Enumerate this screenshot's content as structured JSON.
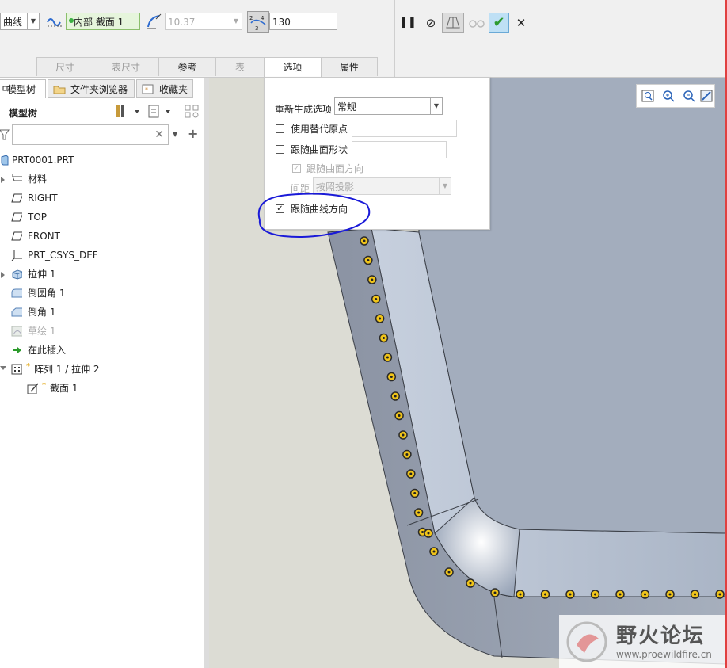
{
  "dashboard": {
    "curve_type": "曲线",
    "section_combo": "内部 截面 1",
    "distance_value": "10.37",
    "count_value": "130",
    "tabs": [
      {
        "label": "尺寸",
        "state": "disabled"
      },
      {
        "label": "表尺寸",
        "state": "disabled"
      },
      {
        "label": "参考",
        "state": "enabled"
      },
      {
        "label": "表",
        "state": "disabled"
      },
      {
        "label": "选项",
        "state": "active"
      },
      {
        "label": "属性",
        "state": "enabled"
      }
    ],
    "actions": {
      "pause": "❚❚",
      "stop": "⊘",
      "ok": "✔",
      "cancel": "✕"
    }
  },
  "options_panel": {
    "regen_label": "重新生成选项",
    "regen_value": "常规",
    "alt_origin_label": "使用替代原点",
    "follow_surface_shape_label": "跟随曲面形状",
    "follow_surface_dir_label": "跟随曲面方向",
    "spacing_label": "间距",
    "spacing_value": "按照投影",
    "follow_curve_dir_label": "跟随曲线方向",
    "follow_curve_dir_checked": true
  },
  "left_panel": {
    "tabs": [
      "模型树",
      "文件夹浏览器",
      "收藏夹"
    ],
    "header": "模型树",
    "tree": [
      {
        "label": "PRT0001.PRT",
        "icon": "part-icon"
      },
      {
        "label": "材料",
        "icon": "material-icon"
      },
      {
        "label": "RIGHT",
        "icon": "datum-plane-icon"
      },
      {
        "label": "TOP",
        "icon": "datum-plane-icon"
      },
      {
        "label": "FRONT",
        "icon": "datum-plane-icon"
      },
      {
        "label": "PRT_CSYS_DEF",
        "icon": "csys-icon"
      },
      {
        "label": "拉伸 1",
        "icon": "extrude-icon"
      },
      {
        "label": "倒圆角 1",
        "icon": "round-icon"
      },
      {
        "label": "倒角 1",
        "icon": "chamfer-icon"
      },
      {
        "label": "草绘 1",
        "icon": "sketch-icon"
      },
      {
        "label": "在此插入",
        "icon": "insert-here-icon"
      },
      {
        "label": "阵列 1 / 拉伸 2",
        "icon": "pattern-icon"
      },
      {
        "label": "截面 1",
        "icon": "section-icon"
      }
    ]
  },
  "watermark": {
    "title": "野火论坛",
    "url": "www.proewildfire.cn"
  },
  "colors": {
    "active_green": "#3cb043",
    "annotation_blue": "#1a1ad8",
    "hole_yellow": "#f0c419",
    "part_face": "#a3adbd"
  }
}
